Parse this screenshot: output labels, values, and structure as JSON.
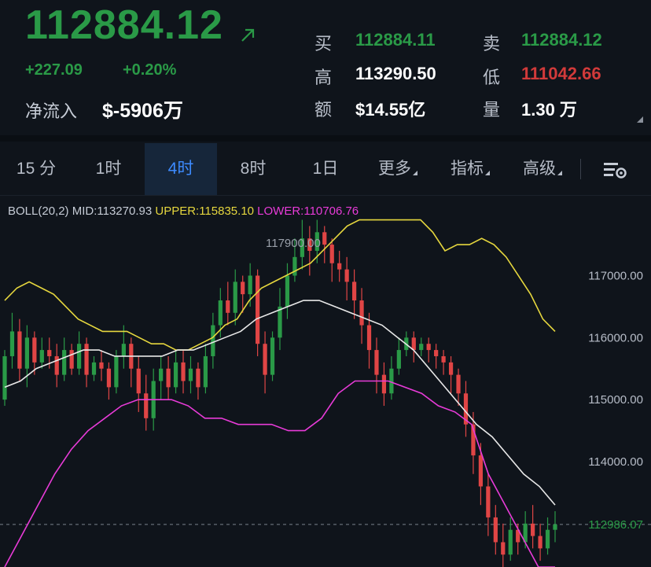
{
  "quote": {
    "price": "112884.12",
    "change": "+227.09",
    "change_pct": "+0.20%",
    "net_inflow_label": "净流入",
    "net_inflow_value": "$-5906万",
    "buy_label": "买",
    "buy_value": "112884.11",
    "sell_label": "卖",
    "sell_value": "112884.12",
    "high_label": "高",
    "high_value": "113290.50",
    "low_label": "低",
    "low_value": "111042.66",
    "amount_label": "额",
    "amount_value": "$14.55亿",
    "volume_label": "量",
    "volume_value": "1.30 万"
  },
  "tabs": [
    {
      "label": "15 分",
      "active": false
    },
    {
      "label": "1时",
      "active": false
    },
    {
      "label": "4时",
      "active": true
    },
    {
      "label": "8时",
      "active": false
    },
    {
      "label": "1日",
      "active": false
    },
    {
      "label": "更多",
      "active": false
    },
    {
      "label": "指标",
      "active": false
    },
    {
      "label": "高级",
      "active": false
    }
  ],
  "boll": {
    "name": "BOLL(20,2)",
    "mid": "MID:113270.93",
    "upper": "UPPER:115835.10",
    "lower": "LOWER:110706.76"
  },
  "colors": {
    "up": "#2a9a47",
    "down": "#e04545",
    "upper_band": "#e6d73e",
    "mid_band": "#e8e8e8",
    "lower_band": "#e83bd8",
    "active_tab": "#3d8bff"
  },
  "chart_data": {
    "type": "candlestick",
    "y_ticks": [
      "117000.00",
      "116000.00",
      "115000.00",
      "114000.00"
    ],
    "y_tick_values": [
      117000,
      116000,
      115000,
      114000
    ],
    "ylim": [
      112300,
      118300
    ],
    "max_label": "117900.00",
    "current_price_label": "112986.07",
    "current_price": 112986.07,
    "candles": [
      [
        115000,
        115700,
        114900,
        115800
      ],
      [
        115700,
        116100,
        115500,
        116400
      ],
      [
        116100,
        115500,
        115300,
        116300
      ],
      [
        115500,
        116000,
        115200,
        116200
      ],
      [
        116000,
        115600,
        115400,
        116100
      ],
      [
        115600,
        115800,
        115500,
        116000
      ],
      [
        115800,
        115700,
        115500,
        116000
      ],
      [
        115700,
        115400,
        115200,
        115900
      ],
      [
        115400,
        115800,
        115300,
        116000
      ],
      [
        115800,
        115500,
        115400,
        115900
      ],
      [
        115500,
        115900,
        115400,
        116100
      ],
      [
        115900,
        115400,
        115200,
        116000
      ],
      [
        115400,
        115600,
        115300,
        115700
      ],
      [
        115600,
        115500,
        115300,
        115800
      ],
      [
        115500,
        115200,
        115000,
        115600
      ],
      [
        115200,
        115700,
        115100,
        115800
      ],
      [
        115700,
        115900,
        115500,
        116200
      ],
      [
        115900,
        115500,
        115200,
        116000
      ],
      [
        115500,
        115100,
        114800,
        115700
      ],
      [
        115100,
        114700,
        114500,
        115400
      ],
      [
        114700,
        115300,
        114500,
        115500
      ],
      [
        115300,
        115500,
        115000,
        115700
      ],
      [
        115500,
        115200,
        115000,
        115700
      ],
      [
        115200,
        115600,
        115100,
        115800
      ],
      [
        115600,
        115300,
        115100,
        115800
      ],
      [
        115300,
        115500,
        115100,
        115700
      ],
      [
        115500,
        115200,
        115000,
        115600
      ],
      [
        115200,
        115700,
        115100,
        115900
      ],
      [
        115700,
        116200,
        115500,
        116400
      ],
      [
        116200,
        116600,
        116000,
        116800
      ],
      [
        116600,
        116400,
        116200,
        116900
      ],
      [
        116400,
        116900,
        116200,
        117100
      ],
      [
        116900,
        116700,
        116400,
        117000
      ],
      [
        116700,
        117000,
        116500,
        117200
      ],
      [
        117000,
        115900,
        115700,
        117100
      ],
      [
        115900,
        115400,
        115100,
        116100
      ],
      [
        115400,
        116000,
        115300,
        116100
      ],
      [
        116000,
        116500,
        115800,
        116800
      ],
      [
        116500,
        117000,
        116300,
        117200
      ],
      [
        117000,
        117300,
        116900,
        117600
      ],
      [
        117300,
        117600,
        117100,
        117900
      ],
      [
        117600,
        117400,
        117000,
        117800
      ],
      [
        117400,
        117700,
        117200,
        117900
      ],
      [
        117700,
        117500,
        117200,
        117800
      ],
      [
        117500,
        117200,
        116900,
        117600
      ],
      [
        117200,
        117100,
        116900,
        117400
      ],
      [
        117100,
        116900,
        116600,
        117300
      ],
      [
        116900,
        116600,
        116300,
        117100
      ],
      [
        116600,
        116200,
        115900,
        116800
      ],
      [
        116200,
        115800,
        115500,
        116400
      ],
      [
        115800,
        115400,
        115100,
        116000
      ],
      [
        115400,
        115100,
        114900,
        115600
      ],
      [
        115100,
        115500,
        115000,
        115700
      ],
      [
        115500,
        115800,
        115400,
        116000
      ],
      [
        115800,
        116000,
        115700,
        116100
      ],
      [
        116000,
        115800,
        115600,
        116100
      ],
      [
        115800,
        115900,
        115700,
        116000
      ],
      [
        115900,
        115800,
        115600,
        116000
      ],
      [
        115800,
        115700,
        115500,
        115900
      ],
      [
        115700,
        115600,
        115400,
        115800
      ],
      [
        115600,
        115400,
        115100,
        115700
      ],
      [
        115400,
        115100,
        114900,
        115500
      ],
      [
        115100,
        114600,
        114400,
        115300
      ],
      [
        114600,
        114100,
        113800,
        114800
      ],
      [
        114100,
        113600,
        113300,
        114300
      ],
      [
        113600,
        113100,
        112800,
        113800
      ],
      [
        113100,
        112700,
        112500,
        113300
      ],
      [
        112700,
        112500,
        112300,
        113000
      ],
      [
        112500,
        112900,
        112400,
        113100
      ],
      [
        112900,
        112700,
        112500,
        113000
      ],
      [
        112700,
        113000,
        112600,
        113200
      ],
      [
        113000,
        112800,
        112600,
        113300
      ],
      [
        112800,
        112600,
        112400,
        113000
      ],
      [
        112600,
        112900,
        112500,
        113100
      ],
      [
        112900,
        112986,
        112700,
        113200
      ]
    ],
    "upper_band": [
      116600,
      116800,
      116900,
      116800,
      116700,
      116500,
      116300,
      116200,
      116100,
      116100,
      116100,
      116000,
      115900,
      115900,
      115800,
      115800,
      115900,
      116000,
      116200,
      116300,
      116600,
      116800,
      116900,
      117000,
      117100,
      117200,
      117400,
      117600,
      117800,
      117900,
      117900,
      117900,
      117900,
      117900,
      117900,
      117700,
      117400,
      117500,
      117500,
      117600,
      117500,
      117300,
      117000,
      116700,
      116300,
      116100
    ],
    "mid_band": [
      115200,
      115300,
      115500,
      115600,
      115700,
      115800,
      115800,
      115700,
      115700,
      115700,
      115700,
      115800,
      115800,
      115900,
      116000,
      116100,
      116300,
      116400,
      116500,
      116600,
      116600,
      116500,
      116400,
      116300,
      116200,
      116000,
      115800,
      115500,
      115200,
      114900,
      114600,
      114400,
      114100,
      113800,
      113600,
      113300
    ],
    "lower_band": [
      112300,
      112800,
      113300,
      113800,
      114200,
      114500,
      114700,
      114900,
      115000,
      115000,
      115000,
      114900,
      114700,
      114700,
      114600,
      114600,
      114600,
      114500,
      114500,
      114700,
      115100,
      115300,
      115300,
      115300,
      115200,
      115100,
      114900,
      114800,
      114600,
      113800,
      113300,
      112800,
      112300,
      112300
    ],
    "x_domain": [
      0,
      74
    ]
  }
}
